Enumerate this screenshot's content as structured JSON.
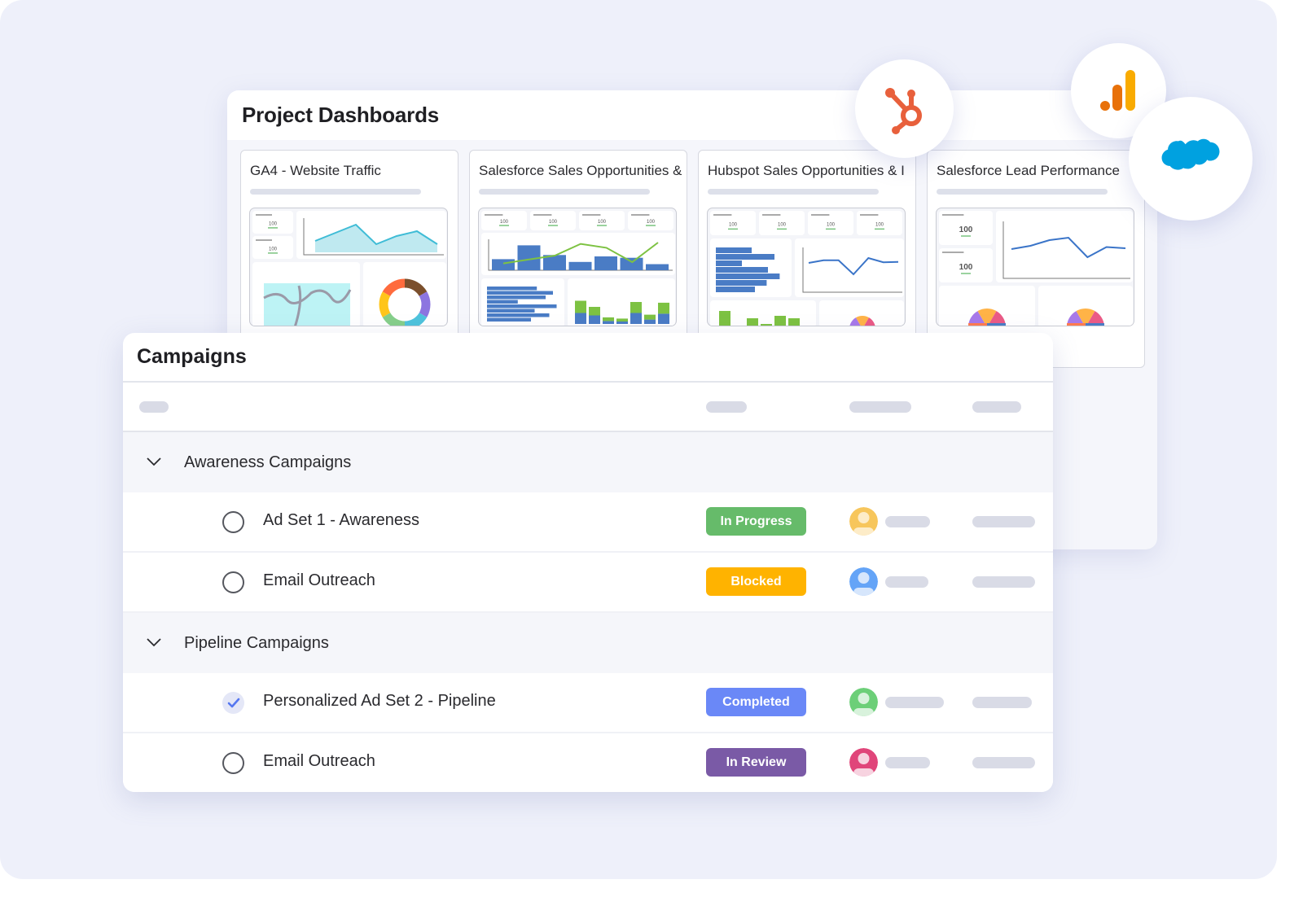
{
  "dashboards": {
    "title": "Project Dashboards",
    "cards": [
      {
        "title": "GA4 - Website Traffic",
        "thumbnail": {
          "kpis": [
            "100",
            "100"
          ],
          "line_chart": [
            0.35,
            0.6,
            0.85,
            0.25,
            0.5,
            0.65,
            0.25
          ],
          "widgets": [
            "area-chart",
            "map",
            "donut-chart"
          ]
        }
      },
      {
        "title": "Salesforce Sales Opportunities &",
        "thumbnail": {
          "kpis": [
            "100",
            "100",
            "100",
            "100"
          ],
          "bars": [
            0.4,
            0.9,
            0.55,
            0.3,
            0.5,
            0.45,
            0.22
          ],
          "line": [
            0.2,
            0.35,
            0.5,
            0.95,
            0.8,
            0.25,
            1.0
          ],
          "hbars": [
            0.68,
            0.9,
            0.8,
            0.42,
            0.95,
            0.65,
            0.85,
            0.6
          ],
          "stacked": [
            [
              0.5,
              0.45
            ],
            [
              0.35,
              0.35
            ],
            [
              0.15,
              0.12
            ],
            [
              0.12,
              0.1
            ],
            [
              0.45,
              0.45
            ],
            [
              0.2,
              0.18
            ],
            [
              0.45,
              0.42
            ]
          ],
          "widgets": [
            "combo-chart",
            "horizontal-bar-chart",
            "stacked-bar-chart"
          ]
        }
      },
      {
        "title": "Hubspot Sales Opportunities & I",
        "thumbnail": {
          "kpis": [
            "100",
            "100",
            "100",
            "100"
          ],
          "hbars": [
            0.55,
            0.9,
            0.4,
            0.8,
            0.98,
            0.78,
            0.6
          ],
          "line": [
            0.7,
            0.78,
            0.78,
            0.35,
            0.85,
            0.72,
            0.73
          ],
          "vbars": [
            1.0,
            0,
            0.55,
            0.2,
            0.7,
            0.55,
            0.1
          ],
          "widgets": [
            "horizontal-bar-chart",
            "line-chart",
            "bar-chart",
            "pie-chart"
          ]
        }
      },
      {
        "title": "Salesforce Lead Performance",
        "thumbnail": {
          "kpis": [
            "100",
            "100"
          ],
          "line": [
            0.5,
            0.58,
            0.72,
            0.78,
            0.3,
            0.55,
            0.52
          ],
          "widgets": [
            "line-chart",
            "pie-chart",
            "pie-chart"
          ]
        }
      }
    ]
  },
  "integrations": {
    "hubspot": {
      "name": "HubSpot",
      "color": "#e8603c"
    },
    "google_analytics": {
      "name": "Google Analytics",
      "colors": [
        "#e8710a",
        "#f9ab00"
      ]
    },
    "salesforce": {
      "name": "Salesforce",
      "color": "#00a1e0"
    }
  },
  "campaigns": {
    "title": "Campaigns",
    "groups": [
      {
        "label": "Awareness Campaigns",
        "items": [
          {
            "name": "Ad Set 1 - Awareness",
            "checked": false,
            "status": "In Progress",
            "status_color": "#66bb6a",
            "avatar_color": "#f7c65c"
          },
          {
            "name": "Email Outreach",
            "checked": false,
            "status": "Blocked",
            "status_color": "#ffb300",
            "avatar_color": "#64a4f7"
          }
        ]
      },
      {
        "label": "Pipeline Campaigns",
        "items": [
          {
            "name": "Personalized Ad Set 2 - Pipeline",
            "checked": true,
            "status": "Completed",
            "status_color": "#6a88f7",
            "avatar_color": "#6ccf78"
          },
          {
            "name": "Email Outreach",
            "checked": false,
            "status": "In Review",
            "status_color": "#7a5aa6",
            "avatar_color": "#e0457a"
          }
        ]
      }
    ]
  }
}
